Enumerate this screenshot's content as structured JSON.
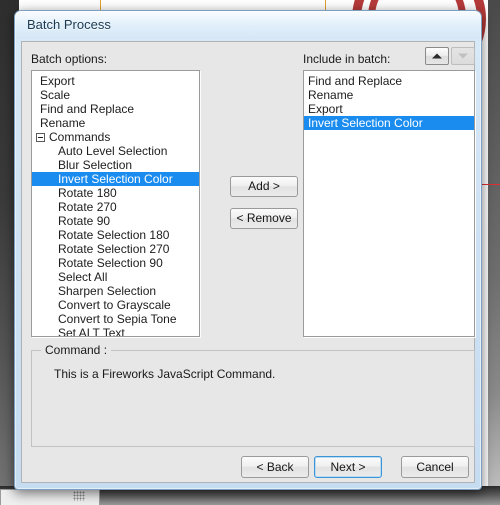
{
  "window": {
    "title": "Batch Process"
  },
  "left_panel": {
    "label": "Batch options:",
    "items": [
      {
        "label": "Export",
        "level": "root",
        "selected": false,
        "expander": false
      },
      {
        "label": "Scale",
        "level": "root",
        "selected": false,
        "expander": false
      },
      {
        "label": "Find and Replace",
        "level": "root",
        "selected": false,
        "expander": false
      },
      {
        "label": "Rename",
        "level": "root",
        "selected": false,
        "expander": false
      },
      {
        "label": "Commands",
        "level": "node",
        "selected": false,
        "expander": true
      },
      {
        "label": "Auto Level Selection",
        "level": "child",
        "selected": false,
        "expander": false
      },
      {
        "label": "Blur Selection",
        "level": "child",
        "selected": false,
        "expander": false
      },
      {
        "label": "Invert Selection Color",
        "level": "child",
        "selected": true,
        "expander": false
      },
      {
        "label": "Rotate 180",
        "level": "child",
        "selected": false,
        "expander": false
      },
      {
        "label": "Rotate 270",
        "level": "child",
        "selected": false,
        "expander": false
      },
      {
        "label": "Rotate 90",
        "level": "child",
        "selected": false,
        "expander": false
      },
      {
        "label": "Rotate Selection 180",
        "level": "child",
        "selected": false,
        "expander": false
      },
      {
        "label": "Rotate Selection 270",
        "level": "child",
        "selected": false,
        "expander": false
      },
      {
        "label": "Rotate Selection 90",
        "level": "child",
        "selected": false,
        "expander": false
      },
      {
        "label": "Select All",
        "level": "child",
        "selected": false,
        "expander": false
      },
      {
        "label": "Sharpen Selection",
        "level": "child",
        "selected": false,
        "expander": false
      },
      {
        "label": "Convert to Grayscale",
        "level": "child",
        "selected": false,
        "expander": false
      },
      {
        "label": "Convert to Sepia Tone",
        "level": "child",
        "selected": false,
        "expander": false
      },
      {
        "label": "Set ALT Text",
        "level": "child",
        "selected": false,
        "expander": false
      }
    ]
  },
  "transfer": {
    "add_label": "Add >",
    "remove_label": "< Remove"
  },
  "right_panel": {
    "label": "Include in batch:",
    "move_up_icon": "triangle-up-icon",
    "move_down_icon": "triangle-down-icon",
    "move_up_enabled": "true",
    "move_down_enabled": "false",
    "items": [
      {
        "label": "Find and Replace",
        "selected": false
      },
      {
        "label": "Rename",
        "selected": false
      },
      {
        "label": "Export",
        "selected": false
      },
      {
        "label": "Invert Selection Color",
        "selected": true
      }
    ]
  },
  "command_group": {
    "title": "Command :",
    "description": "This is a Fireworks JavaScript Command."
  },
  "footer": {
    "back_label": "< Back",
    "next_label": "Next >",
    "cancel_label": "Cancel"
  },
  "colors": {
    "selection_blue": "#1a8cf0",
    "dialog_blue": "#cfe2f4",
    "guide_red": "#e03030",
    "guide_orange": "#e0a030"
  }
}
